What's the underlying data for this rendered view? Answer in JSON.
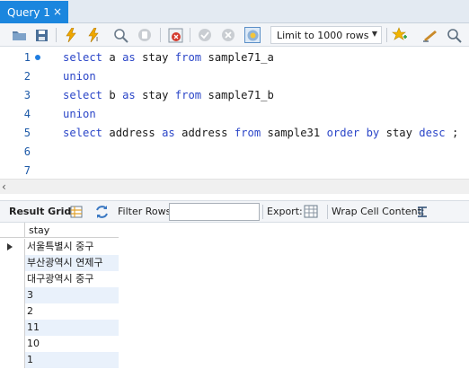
{
  "tab": {
    "title": "Query 1",
    "close": "×"
  },
  "toolbar": {
    "icons": [
      "open-folder-icon",
      "save-icon",
      "execute-icon",
      "execute-current-icon",
      "explain-icon",
      "stop-icon",
      "toggle-error-icon",
      "commit-icon",
      "rollback-icon",
      "autocommit-icon",
      "add-snippet-icon",
      "beautify-icon",
      "search-icon"
    ],
    "limit_select": "Limit to 1000 rows"
  },
  "editor": {
    "lines": [
      {
        "number": "1",
        "segments": [
          [
            "kw",
            "select"
          ],
          [
            "",
            "a "
          ],
          [
            "kw",
            "as"
          ],
          [
            "",
            "stay "
          ],
          [
            "kw",
            "from"
          ],
          [
            "",
            "sample71_a"
          ]
        ]
      },
      {
        "number": "2",
        "segments": [
          [
            "kw",
            "union"
          ]
        ]
      },
      {
        "number": "3",
        "segments": [
          [
            "kw",
            "select"
          ],
          [
            "",
            "b "
          ],
          [
            "kw",
            "as"
          ],
          [
            "",
            "stay "
          ],
          [
            "kw",
            "from"
          ],
          [
            "",
            "sample71_b"
          ]
        ]
      },
      {
        "number": "4",
        "segments": [
          [
            "kw",
            "union"
          ]
        ]
      },
      {
        "number": "5",
        "segments": [
          [
            "kw",
            "select"
          ],
          [
            "",
            "address "
          ],
          [
            "kw",
            "as"
          ],
          [
            "",
            "address "
          ],
          [
            "kw",
            "from"
          ],
          [
            "",
            "sample31 "
          ],
          [
            "kw",
            "order by"
          ],
          [
            "",
            "stay "
          ],
          [
            "kw",
            "desc"
          ],
          [
            "",
            ";"
          ]
        ]
      },
      {
        "number": "6",
        "segments": []
      },
      {
        "number": "7",
        "segments": []
      }
    ]
  },
  "result_toolbar": {
    "result_grid": "Result Grid",
    "filter_rows": "Filter Rows:",
    "export": "Export:",
    "wrap_cell": "Wrap Cell Content:"
  },
  "grid": {
    "column": "stay",
    "rows": [
      "서울특별시 중구",
      "부산광역시 연제구",
      "대구광역시 중구",
      "3",
      "2",
      "11",
      "10",
      "1"
    ]
  }
}
